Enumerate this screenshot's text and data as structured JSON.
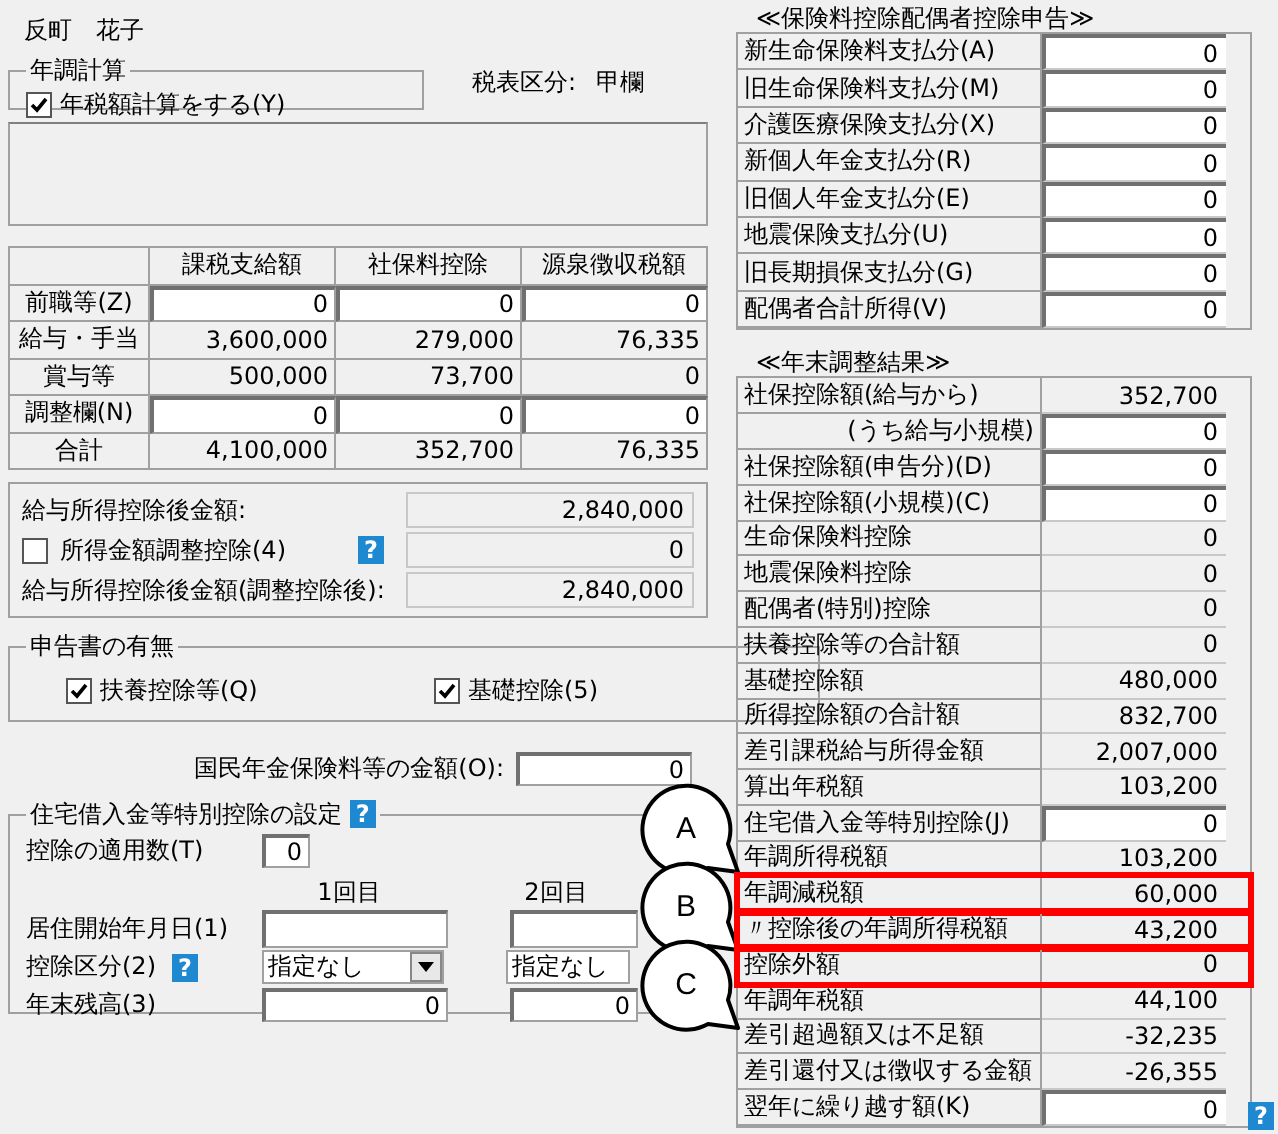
{
  "employee_name": "反町　花子",
  "year_end_calc": {
    "title": "年調計算",
    "checkbox": {
      "label": "年税額計算をする(Y)",
      "checked": true
    }
  },
  "tax_table": {
    "label": "税表区分:",
    "value": "甲欄"
  },
  "income_table": {
    "columns": [
      "課税支給額",
      "社保料控除",
      "源泉徴収税額"
    ],
    "rows": [
      {
        "label": "前職等(Z)",
        "kind": "input",
        "cells": [
          "0",
          "0",
          "0"
        ]
      },
      {
        "label": "給与・手当",
        "kind": "readonly",
        "cells": [
          "3,600,000",
          "279,000",
          "76,335"
        ]
      },
      {
        "label": "賞与等",
        "kind": "readonly",
        "cells": [
          "500,000",
          "73,700",
          "0"
        ]
      },
      {
        "label": "調整欄(N)",
        "kind": "input",
        "cells": [
          "0",
          "0",
          "0"
        ]
      },
      {
        "label": "合計",
        "kind": "readonly",
        "cells": [
          "4,100,000",
          "352,700",
          "76,335"
        ]
      }
    ]
  },
  "income_summary": [
    {
      "kind": "text",
      "label": "給与所得控除後金額:",
      "value": "2,840,000"
    },
    {
      "kind": "checkbox",
      "label": "所得金額調整控除(4)",
      "checked": false,
      "help": "?",
      "value": "0"
    },
    {
      "kind": "text",
      "label": "給与所得控除後金額(調整控除後):",
      "value": "2,840,000"
    }
  ],
  "declarations": {
    "title": "申告書の有無",
    "items": [
      {
        "label": "扶養控除等(Q)",
        "checked": true
      },
      {
        "label": "基礎控除(5)",
        "checked": true
      }
    ]
  },
  "pension": {
    "label": "国民年金保険料等の金額(O):",
    "value": "0"
  },
  "housing_loan": {
    "title": "住宅借入金等特別控除の設定",
    "help": "?",
    "count_label": "控除の適用数(T)",
    "count": "0",
    "columns": [
      "1回目",
      "2回目"
    ],
    "rows": [
      {
        "label": "居住開始年月日(1)",
        "kind": "date"
      },
      {
        "label": "控除区分(2)",
        "kind": "select",
        "help": "?",
        "values": [
          "指定なし",
          "指定なし"
        ]
      },
      {
        "label": "年末残高(3)",
        "kind": "amount",
        "values": [
          "0",
          "0"
        ]
      }
    ]
  },
  "insurance": {
    "title": "≪保険料控除配偶者控除申告≫",
    "rows": [
      {
        "label": "新生命保険料支払分(A)",
        "value": "0",
        "kind": "input"
      },
      {
        "label": "旧生命保険料支払分(M)",
        "value": "0",
        "kind": "input"
      },
      {
        "label": "介護医療保険支払分(X)",
        "value": "0",
        "kind": "input"
      },
      {
        "label": "新個人年金支払分(R)",
        "value": "0",
        "kind": "input"
      },
      {
        "label": "旧個人年金支払分(E)",
        "value": "0",
        "kind": "input"
      },
      {
        "label": "地震保険支払分(U)",
        "value": "0",
        "kind": "input"
      },
      {
        "label": "旧長期損保支払分(G)",
        "value": "0",
        "kind": "input"
      },
      {
        "label": "配偶者合計所得(V)",
        "value": "0",
        "kind": "input"
      }
    ]
  },
  "results": {
    "title": "≪年末調整結果≫",
    "help": "?",
    "rows": [
      {
        "label": "社保控除額(給与から)",
        "value": "352,700",
        "kind": "readonly",
        "highlighted": false
      },
      {
        "label": "(うち給与小規模)",
        "value": "0",
        "kind": "input",
        "sub": true,
        "highlighted": false
      },
      {
        "label": "社保控除額(申告分)(D)",
        "value": "0",
        "kind": "input",
        "highlighted": false
      },
      {
        "label": "社保控除額(小規模)(C)",
        "value": "0",
        "kind": "input",
        "highlighted": false
      },
      {
        "label": "生命保険料控除",
        "value": "0",
        "kind": "readonly",
        "highlighted": false
      },
      {
        "label": "地震保険料控除",
        "value": "0",
        "kind": "readonly",
        "highlighted": false
      },
      {
        "label": "配偶者(特別)控除",
        "value": "0",
        "kind": "readonly",
        "highlighted": false
      },
      {
        "label": "扶養控除等の合計額",
        "value": "0",
        "kind": "readonly",
        "highlighted": false
      },
      {
        "label": "基礎控除額",
        "value": "480,000",
        "kind": "readonly",
        "highlighted": false
      },
      {
        "label": "所得控除額の合計額",
        "value": "832,700",
        "kind": "readonly",
        "highlighted": false
      },
      {
        "label": "差引課税給与所得金額",
        "value": "2,007,000",
        "kind": "readonly",
        "highlighted": false
      },
      {
        "label": "算出年税額",
        "value": "103,200",
        "kind": "readonly",
        "highlighted": false
      },
      {
        "label": "住宅借入金等特別控除(J)",
        "value": "0",
        "kind": "input",
        "highlighted": false
      },
      {
        "label": "年調所得税額",
        "value": "103,200",
        "kind": "readonly",
        "highlighted": false
      },
      {
        "label": "年調減税額",
        "value": "60,000",
        "kind": "readonly",
        "highlighted": true
      },
      {
        "label": "〃控除後の年調所得税額",
        "value": "43,200",
        "kind": "readonly",
        "highlighted": true
      },
      {
        "label": "控除外額",
        "value": "0",
        "kind": "readonly",
        "highlighted": true
      },
      {
        "label": "年調年税額",
        "value": "44,100",
        "kind": "readonly",
        "highlighted": false
      },
      {
        "label": "差引超過額又は不足額",
        "value": "-32,235",
        "kind": "readonly",
        "highlighted": false
      },
      {
        "label": "差引還付又は徴収する金額",
        "value": "-26,355",
        "kind": "readonly",
        "highlighted": false
      },
      {
        "label": "翌年に繰り越す額(K)",
        "value": "0",
        "kind": "input",
        "highlighted": false
      }
    ]
  },
  "callouts": [
    {
      "label": "A"
    },
    {
      "label": "B"
    },
    {
      "label": "C"
    }
  ]
}
